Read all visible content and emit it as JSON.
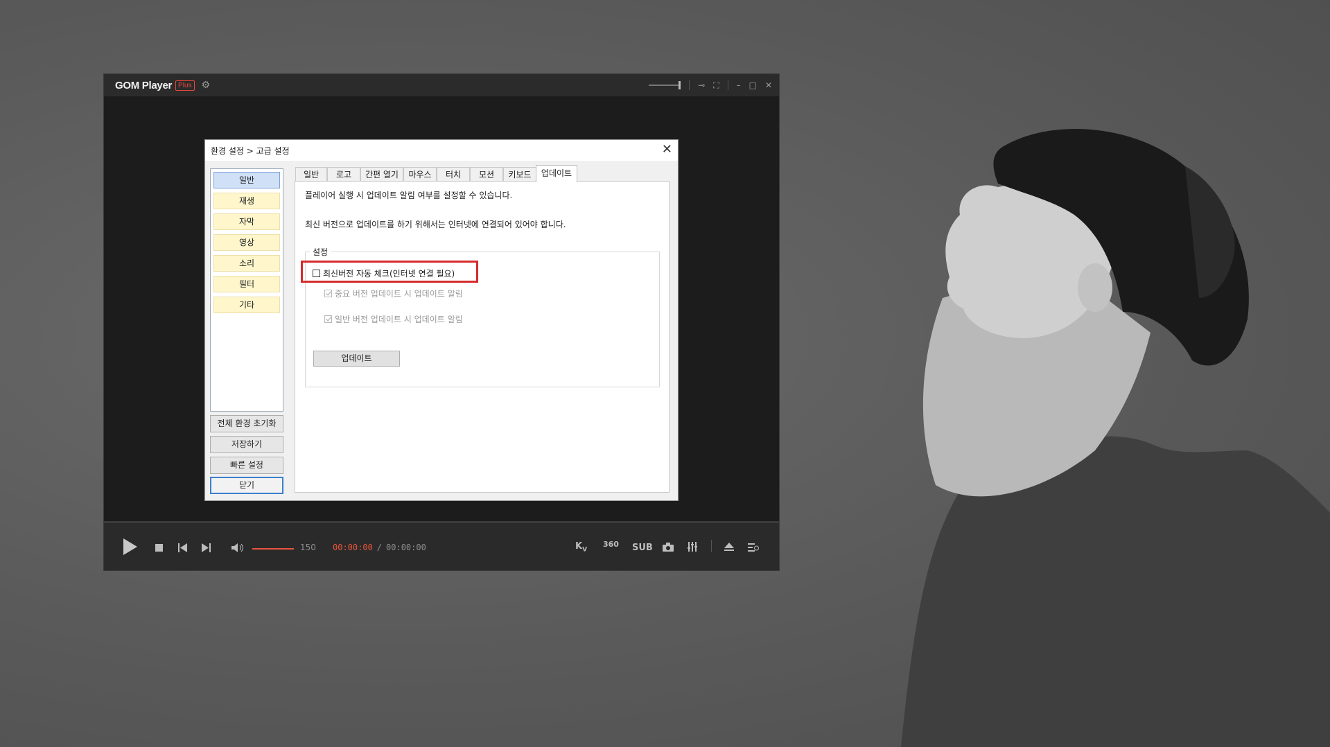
{
  "player": {
    "logo": "GOM Player",
    "badge": "Plus",
    "volume_value": "150",
    "time_current": "00:00:00",
    "time_separator": "/",
    "time_total": "00:00:00",
    "sub_label": "SUB",
    "vr_label": "360"
  },
  "dialog": {
    "title": "환경 설정 > 고급 설정",
    "nav_items": [
      "일반",
      "재생",
      "자막",
      "영상",
      "소리",
      "필터",
      "기타"
    ],
    "side_buttons": {
      "reset": "전체 환경 초기화",
      "save": "저장하기",
      "quick": "빠른 설정",
      "close": "닫기"
    },
    "tabs": [
      "일반",
      "로고",
      "간편 열기",
      "마우스",
      "터치",
      "모션",
      "키보드",
      "업데이트"
    ],
    "active_tab": "업데이트",
    "desc1": "플레이어 실행 시 업데이트 알림 여부를 설정할 수 있습니다.",
    "desc2": "최신 버전으로 업데이트를 하기 위해서는 인터넷에 연결되어 있어야 합니다.",
    "group_label": "설정",
    "options": {
      "auto_check": "최신버전 자동 체크(인터넷 연결 필요)",
      "important": "중요 버전 업데이트 시 업데이트 알림",
      "general": "일반 버전 업데이트 시 업데이트 알림"
    },
    "auto_check_checked": false,
    "important_checked": true,
    "general_checked": true,
    "update_button": "업데이트"
  },
  "colors": {
    "accent": "#e9553c",
    "highlight": "#d52b2b"
  }
}
